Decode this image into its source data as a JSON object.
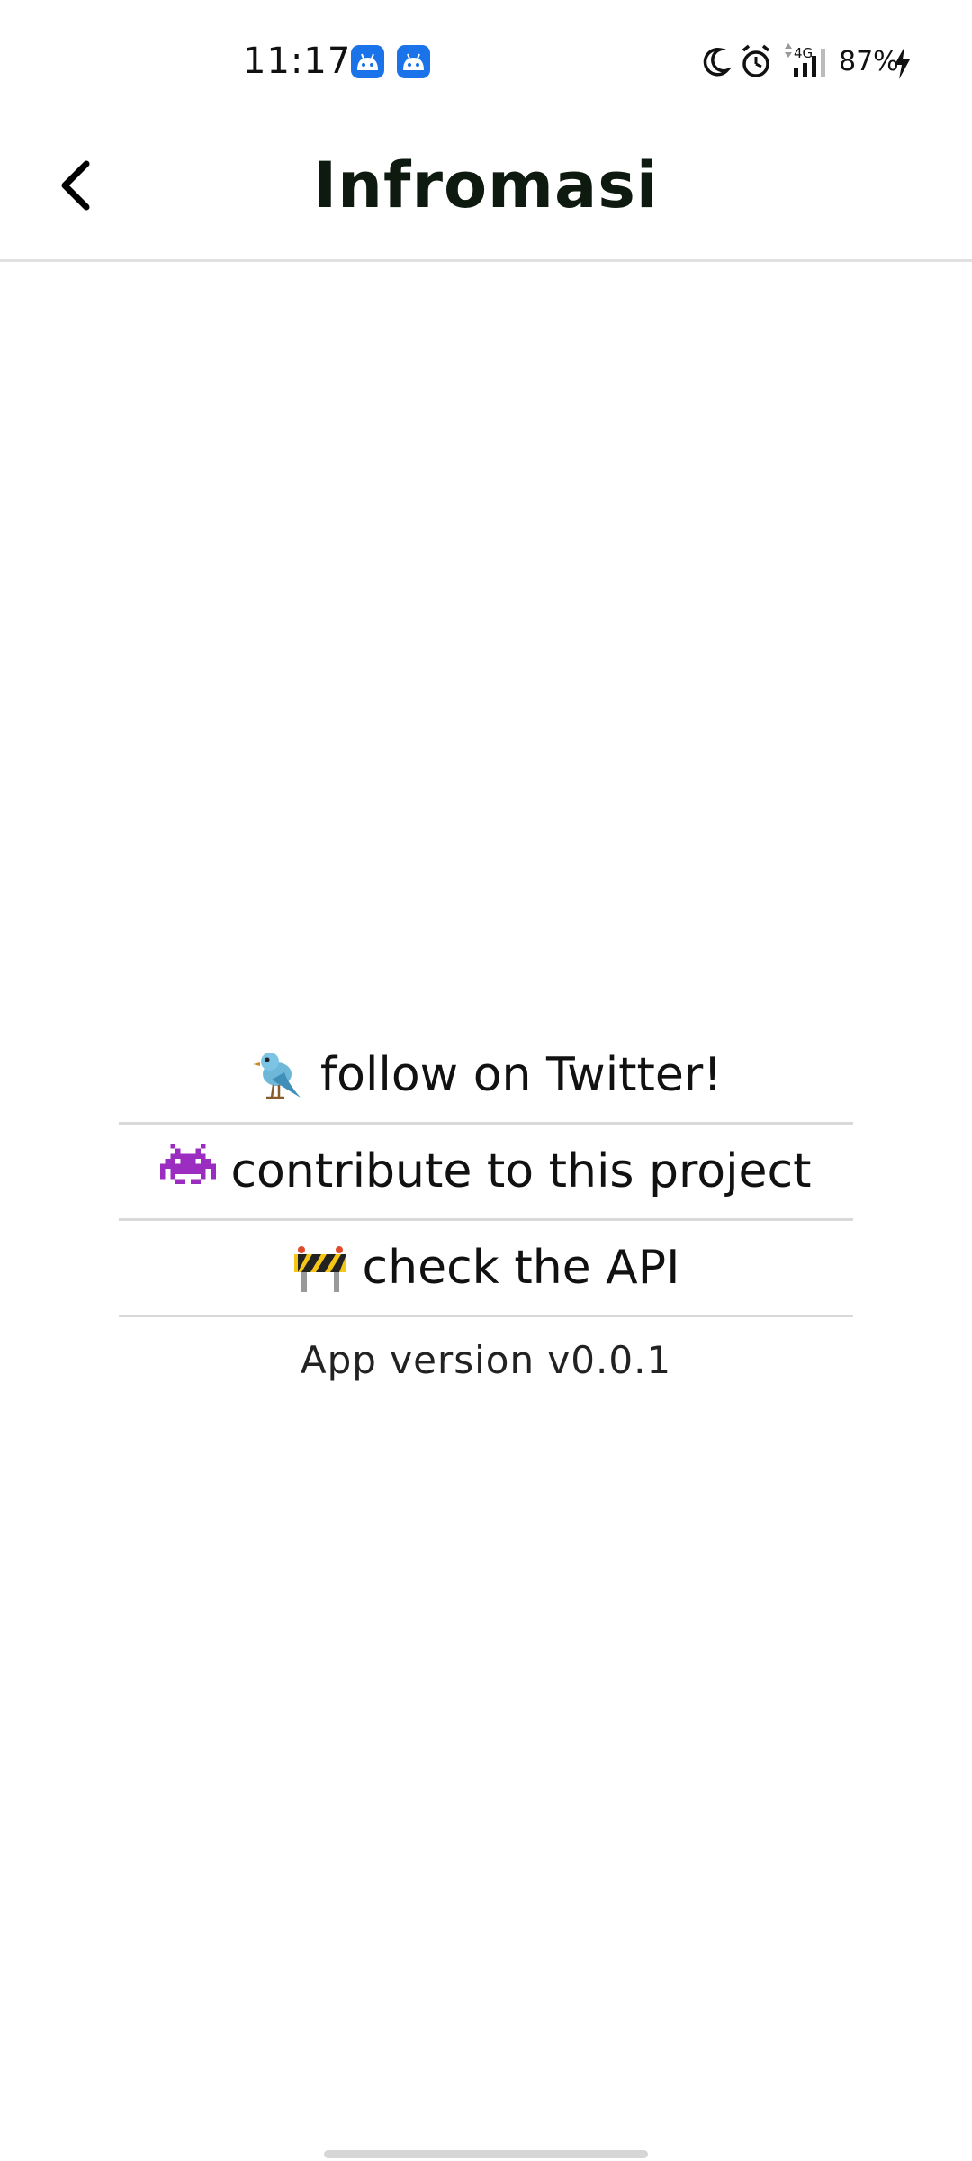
{
  "status_bar": {
    "time": "11:17",
    "network": "4G",
    "battery": "87%",
    "icons": [
      "android-notification-icon",
      "android-notification-icon",
      "moon-icon",
      "alarm-icon",
      "signal-icon",
      "charging-icon"
    ],
    "notification_color": "#1a73e8"
  },
  "app_bar": {
    "title": "Infromasi",
    "back_icon": "chevron-left-icon"
  },
  "menu": {
    "items": [
      {
        "emoji": "bird",
        "label": "follow on Twitter!"
      },
      {
        "emoji": "alien-monster",
        "label": "contribute to this project"
      },
      {
        "emoji": "construction-barrier",
        "label": "check the API"
      }
    ],
    "version_text": "App version v0.0.1"
  },
  "colors": {
    "title": "#0e1a0f",
    "divider": "#d9d9d9"
  }
}
